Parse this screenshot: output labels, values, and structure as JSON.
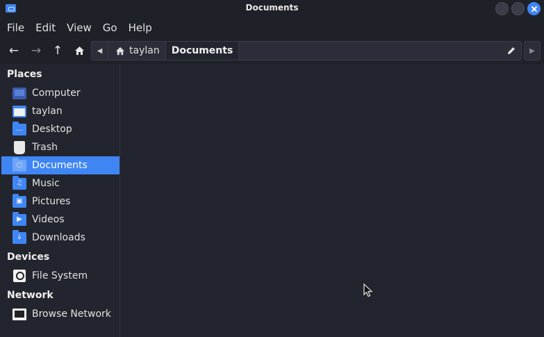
{
  "window": {
    "title": "Documents"
  },
  "menu": [
    "File",
    "Edit",
    "View",
    "Go",
    "Help"
  ],
  "toolbar": {
    "back_icon": "arrow-left-icon",
    "forward_icon": "arrow-right-icon",
    "up_icon": "arrow-up-icon",
    "home_icon": "home-icon"
  },
  "pathbar": {
    "home_crumb": "taylan",
    "current_crumb": "Documents",
    "edit_icon": "pencil-icon"
  },
  "sidebar": {
    "places_title": "Places",
    "places": [
      {
        "label": "Computer",
        "icon": "computer-icon"
      },
      {
        "label": "taylan",
        "icon": "home-folder-icon"
      },
      {
        "label": "Desktop",
        "icon": "desktop-folder-icon"
      },
      {
        "label": "Trash",
        "icon": "trash-icon"
      },
      {
        "label": "Documents",
        "icon": "documents-folder-icon",
        "selected": true
      },
      {
        "label": "Music",
        "icon": "music-folder-icon"
      },
      {
        "label": "Pictures",
        "icon": "pictures-folder-icon"
      },
      {
        "label": "Videos",
        "icon": "videos-folder-icon"
      },
      {
        "label": "Downloads",
        "icon": "downloads-folder-icon"
      }
    ],
    "devices_title": "Devices",
    "devices": [
      {
        "label": "File System",
        "icon": "drive-icon"
      }
    ],
    "network_title": "Network",
    "network": [
      {
        "label": "Browse Network",
        "icon": "network-icon"
      }
    ]
  },
  "colors": {
    "accent": "#3f86f4",
    "background": "#23252e",
    "chrome": "#1f2129"
  }
}
